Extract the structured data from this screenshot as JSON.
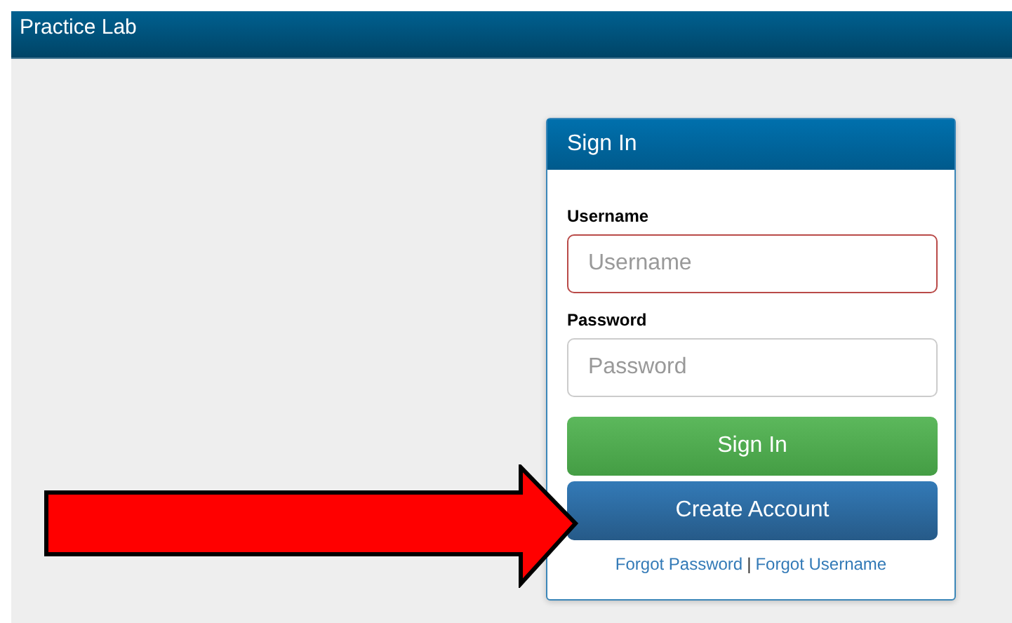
{
  "navbar": {
    "title": "Practice Lab"
  },
  "panel": {
    "title": "Sign In",
    "fields": [
      {
        "label": "Username",
        "placeholder": "Username",
        "invalid": true
      },
      {
        "label": "Password",
        "placeholder": "Password",
        "invalid": false
      }
    ],
    "buttons": [
      {
        "label": "Sign In",
        "kind": "success"
      },
      {
        "label": "Create Account",
        "kind": "primary"
      }
    ],
    "links": [
      "Forgot Password",
      "Forgot Username"
    ],
    "separator": "|"
  },
  "annotation": {
    "kind": "arrow"
  }
}
